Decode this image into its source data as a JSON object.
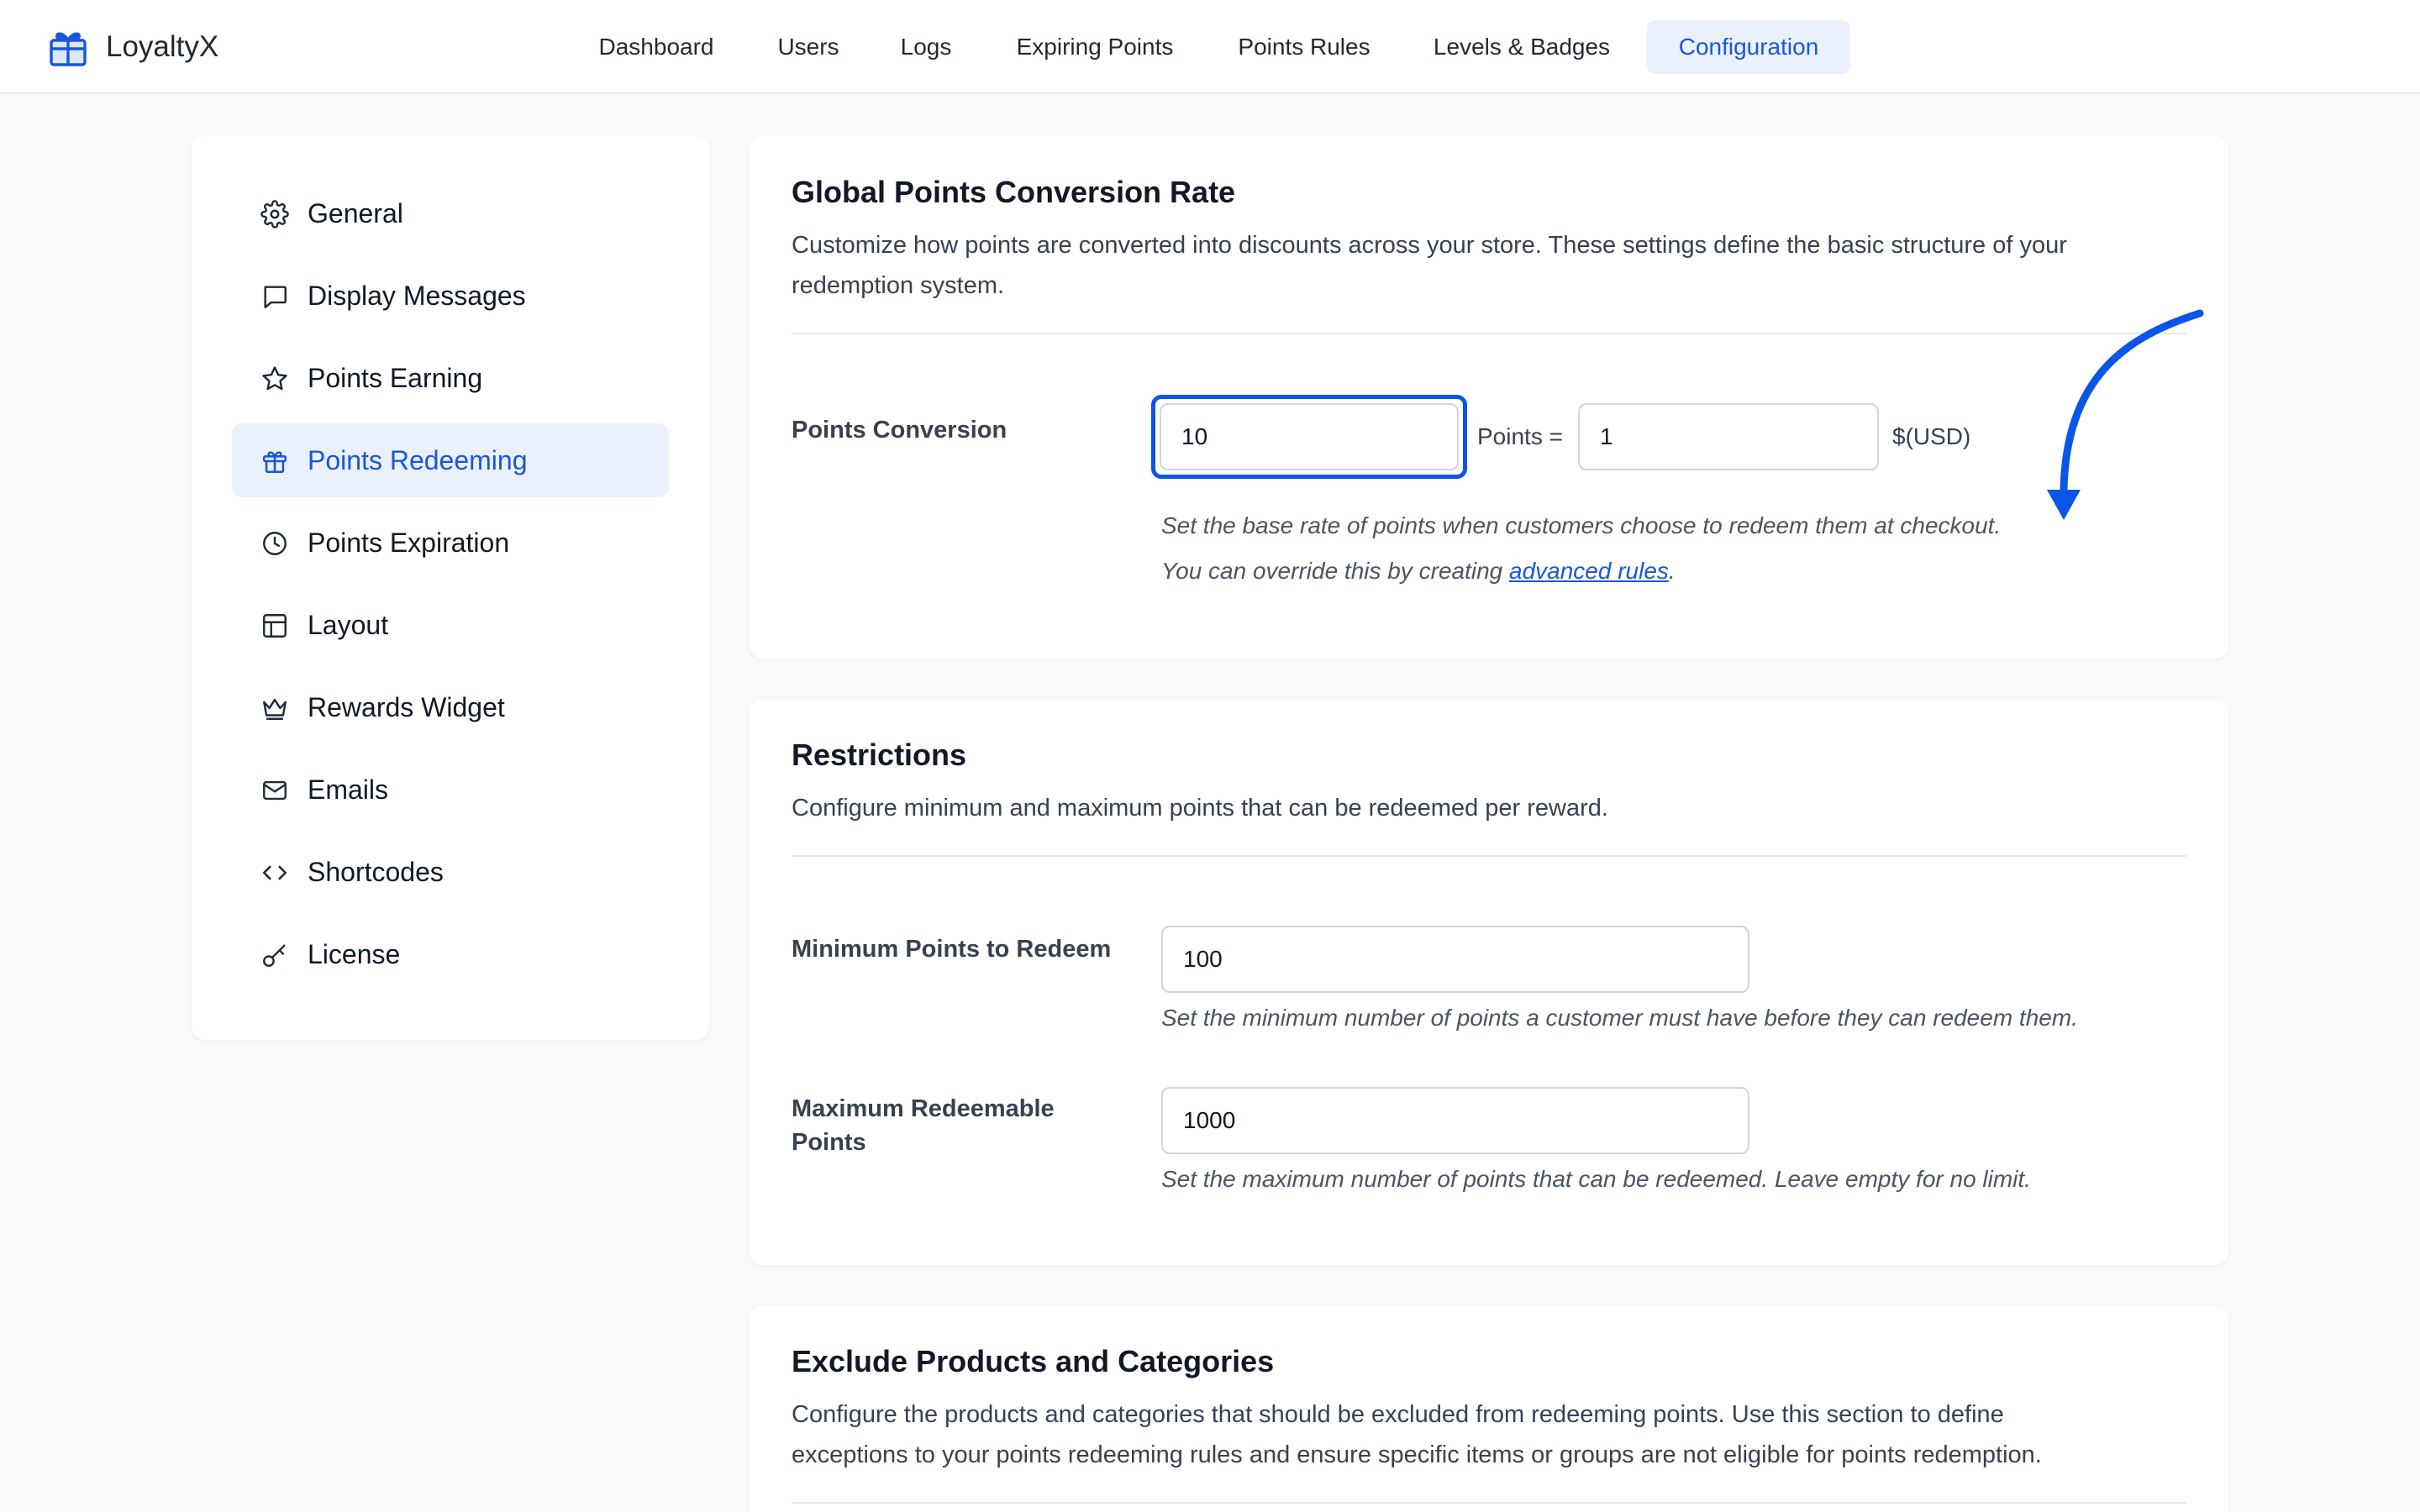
{
  "app": {
    "name": "LoyaltyX",
    "accent": "#1a56db",
    "annotation_color": "#0b55e8"
  },
  "nav": [
    {
      "label": "Dashboard",
      "active": false
    },
    {
      "label": "Users",
      "active": false
    },
    {
      "label": "Logs",
      "active": false
    },
    {
      "label": "Expiring Points",
      "active": false
    },
    {
      "label": "Points Rules",
      "active": false
    },
    {
      "label": "Levels & Badges",
      "active": false
    },
    {
      "label": "Configuration",
      "active": true
    }
  ],
  "sidebar": [
    {
      "label": "General",
      "icon": "gear-icon",
      "active": false
    },
    {
      "label": "Display Messages",
      "icon": "chat-bubble-icon",
      "active": false
    },
    {
      "label": "Points Earning",
      "icon": "star-icon",
      "active": false
    },
    {
      "label": "Points Redeeming",
      "icon": "gift-icon",
      "active": true
    },
    {
      "label": "Points Expiration",
      "icon": "clock-icon",
      "active": false
    },
    {
      "label": "Layout",
      "icon": "layout-icon",
      "active": false
    },
    {
      "label": "Rewards Widget",
      "icon": "crown-icon",
      "active": false
    },
    {
      "label": "Emails",
      "icon": "envelope-icon",
      "active": false
    },
    {
      "label": "Shortcodes",
      "icon": "code-icon",
      "active": false
    },
    {
      "label": "License",
      "icon": "key-icon",
      "active": false
    }
  ],
  "conversion": {
    "title": "Global Points Conversion Rate",
    "desc_line1": "Customize how points are converted into discounts across your store. These settings define the basic structure of your",
    "desc_line2": "redemption system.",
    "label": "Points Conversion",
    "points_value": "10",
    "points_unit": "Points =",
    "currency_value": "1",
    "currency_unit": "$(USD)",
    "help_line1": "Set the base rate of points when customers choose to redeem them at checkout.",
    "help_line2_prefix": "You can override this by creating ",
    "help_link": "advanced rules",
    "help_line2_suffix": "."
  },
  "restrictions": {
    "title": "Restrictions",
    "desc": "Configure minimum and maximum points that can be redeemed per reward.",
    "min_label": "Minimum Points to Redeem",
    "min_value": "100",
    "min_help": "Set the minimum number of points a customer must have before they can redeem them.",
    "max_label_line1": "Maximum Redeemable",
    "max_label_line2": "Points",
    "max_value": "1000",
    "max_help": "Set the maximum number of points that can be redeemed. Leave empty for no limit."
  },
  "exclude": {
    "title": "Exclude Products and Categories",
    "desc_line1": "Configure the products and categories that should be excluded from redeeming points. Use this section to define",
    "desc_line2": "exceptions to your points redeeming rules and ensure specific items or groups are not eligible for points redemption."
  }
}
